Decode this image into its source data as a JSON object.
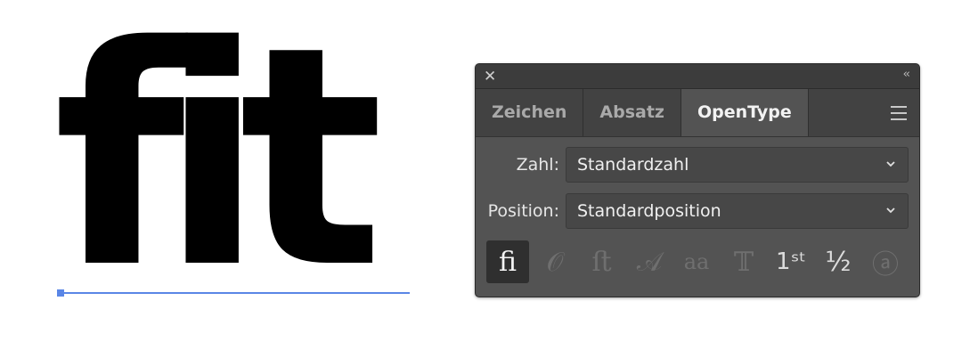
{
  "artboard": {
    "sample_text": "fit"
  },
  "panel": {
    "close_glyph": "✕",
    "collapse_glyph": "‹‹",
    "tabs": [
      {
        "label": "Zeichen",
        "active": false
      },
      {
        "label": "Absatz",
        "active": false
      },
      {
        "label": "OpenType",
        "active": true
      }
    ],
    "number_row": {
      "label": "Zahl:",
      "value": "Standardzahl"
    },
    "position_row": {
      "label": "Position:",
      "value": "Standardposition"
    },
    "glyphs": [
      {
        "name": "ligature",
        "text": "ﬁ",
        "state": "active"
      },
      {
        "name": "contextual-alternate",
        "text": "𝒪",
        "state": "disabled"
      },
      {
        "name": "discretionary-ligature",
        "text": "ﬅ",
        "state": "disabled"
      },
      {
        "name": "swash",
        "text": "𝒜",
        "state": "disabled"
      },
      {
        "name": "stylistic-alternate",
        "text": "aa",
        "state": "disabled"
      },
      {
        "name": "titling-alternate",
        "text": "𝕋",
        "state": "disabled"
      },
      {
        "name": "ordinal",
        "text": "1ˢᵗ",
        "state": "enabled"
      },
      {
        "name": "fraction",
        "text": "½",
        "state": "enabled"
      },
      {
        "name": "stylistic-set",
        "text": "ⓐ",
        "state": "disabled"
      }
    ]
  },
  "colors": {
    "baseline": "#5a86e6",
    "panel_bg": "#535353",
    "active_tab_bg": "#535353"
  }
}
